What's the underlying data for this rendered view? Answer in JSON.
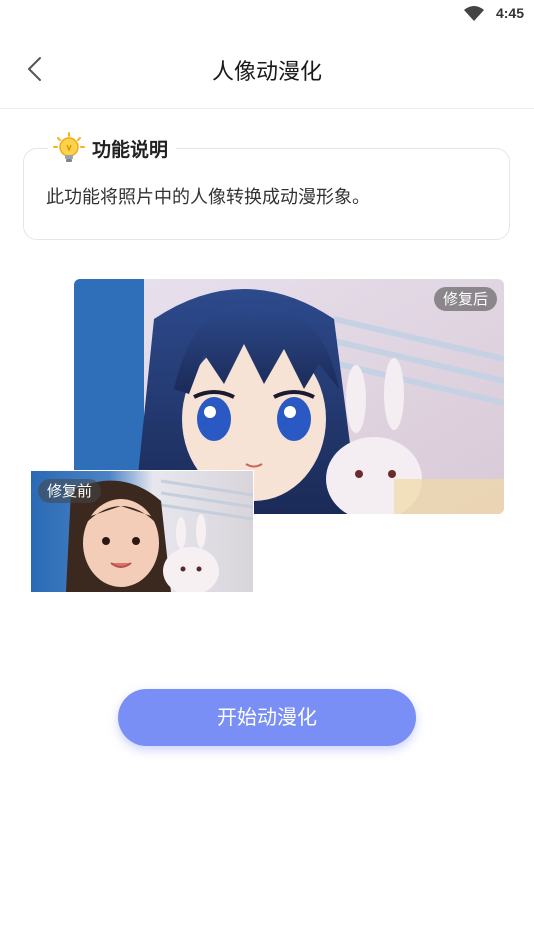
{
  "status_bar": {
    "time": "4:45",
    "wifi_icon": "wifi-icon"
  },
  "header": {
    "title": "人像动漫化",
    "back_icon": "chevron-left-icon"
  },
  "info_card": {
    "icon": "lightbulb-icon",
    "title": "功能说明",
    "description": "此功能将照片中的人像转换成动漫形象。"
  },
  "preview": {
    "after_label": "修复后",
    "before_label": "修复前"
  },
  "actions": {
    "start_label": "开始动漫化"
  },
  "colors": {
    "accent": "#7a8ff5",
    "badge_bg": "#464646"
  }
}
